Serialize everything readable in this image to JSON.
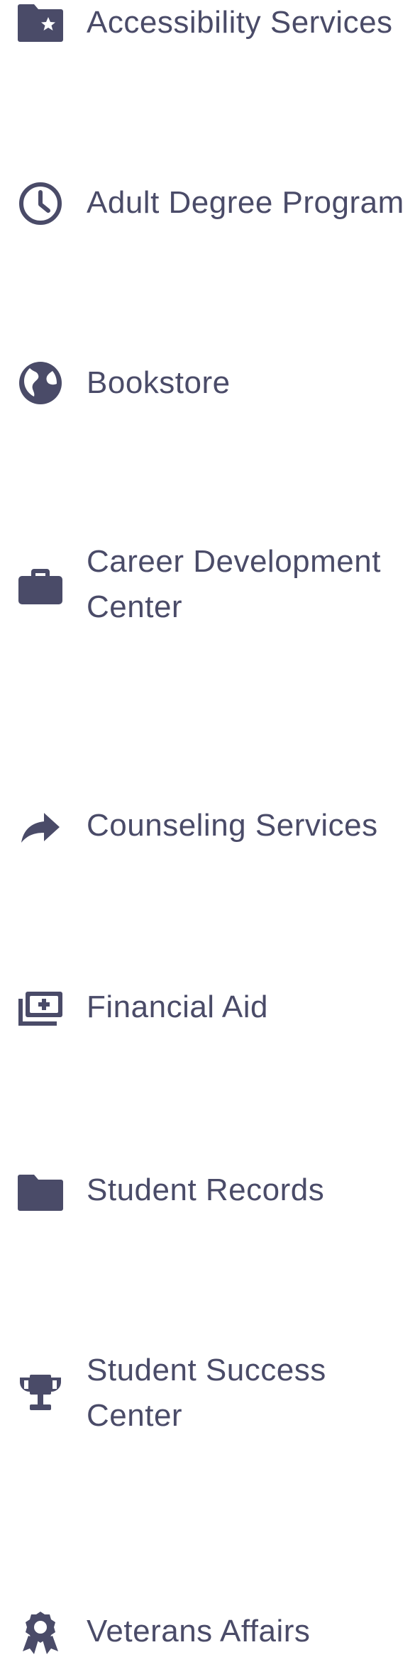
{
  "nav": {
    "items": [
      {
        "label": "Accessibility Services",
        "icon": "folder-star-icon"
      },
      {
        "label": "Adult Degree Program",
        "icon": "clock-icon"
      },
      {
        "label": "Bookstore",
        "icon": "globe-icon"
      },
      {
        "label": "Career Development Center",
        "icon": "briefcase-icon"
      },
      {
        "label": "Counseling Services",
        "icon": "share-arrow-icon"
      },
      {
        "label": "Financial Aid",
        "icon": "money-stack-icon"
      },
      {
        "label": "Student Records",
        "icon": "folder-icon"
      },
      {
        "label": "Student Success Center",
        "icon": "trophy-icon"
      },
      {
        "label": "Veterans Affairs",
        "icon": "award-ribbon-icon"
      }
    ]
  },
  "colors": {
    "text": "#4a4b68",
    "icon": "#4a4b68",
    "background": "#ffffff"
  }
}
